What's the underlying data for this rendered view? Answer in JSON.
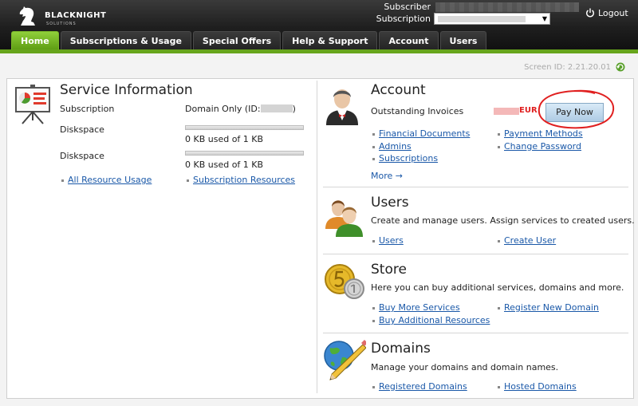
{
  "brand": {
    "name": "BLACKNIGHT",
    "sub": "SOLUTIONS"
  },
  "header": {
    "subscriber_label": "Subscriber",
    "subscription_label": "Subscription",
    "logout_label": "Logout"
  },
  "tabs": [
    {
      "label": "Home",
      "active": true
    },
    {
      "label": "Subscriptions & Usage"
    },
    {
      "label": "Special Offers"
    },
    {
      "label": "Help & Support"
    },
    {
      "label": "Account"
    },
    {
      "label": "Users"
    }
  ],
  "screen_id": "Screen ID: 2.21.20.01",
  "service": {
    "title": "Service Information",
    "subscription_label": "Subscription",
    "subscription_value": "Domain Only (ID:",
    "subscription_close": ")",
    "diskspace_label": "Diskspace",
    "usage_1": "0 KB used of 1 KB",
    "usage_2": "0 KB used of 1 KB",
    "links": [
      "All Resource Usage",
      "Subscription Resources"
    ]
  },
  "account": {
    "title": "Account",
    "outstanding_label": "Outstanding Invoices",
    "currency": "EUR",
    "pay_now": "Pay Now",
    "links_left": [
      "Financial Documents",
      "Admins",
      "Subscriptions"
    ],
    "links_right": [
      "Payment Methods",
      "Change Password"
    ],
    "more": "More →"
  },
  "users": {
    "title": "Users",
    "desc": "Create and manage users. Assign services to created users.",
    "links": [
      "Users",
      "Create User"
    ]
  },
  "store": {
    "title": "Store",
    "desc": "Here you can buy additional services, domains and more.",
    "links_left": [
      "Buy More Services",
      "Buy Additional Resources"
    ],
    "links_right": [
      "Register New Domain"
    ]
  },
  "domains": {
    "title": "Domains",
    "desc": "Manage your domains and domain names.",
    "links": [
      "Registered Domains",
      "Hosted Domains"
    ]
  },
  "colors": {
    "accent_green": "#67a51c",
    "link_blue": "#1a58a8",
    "annotation_red": "#e02020"
  }
}
